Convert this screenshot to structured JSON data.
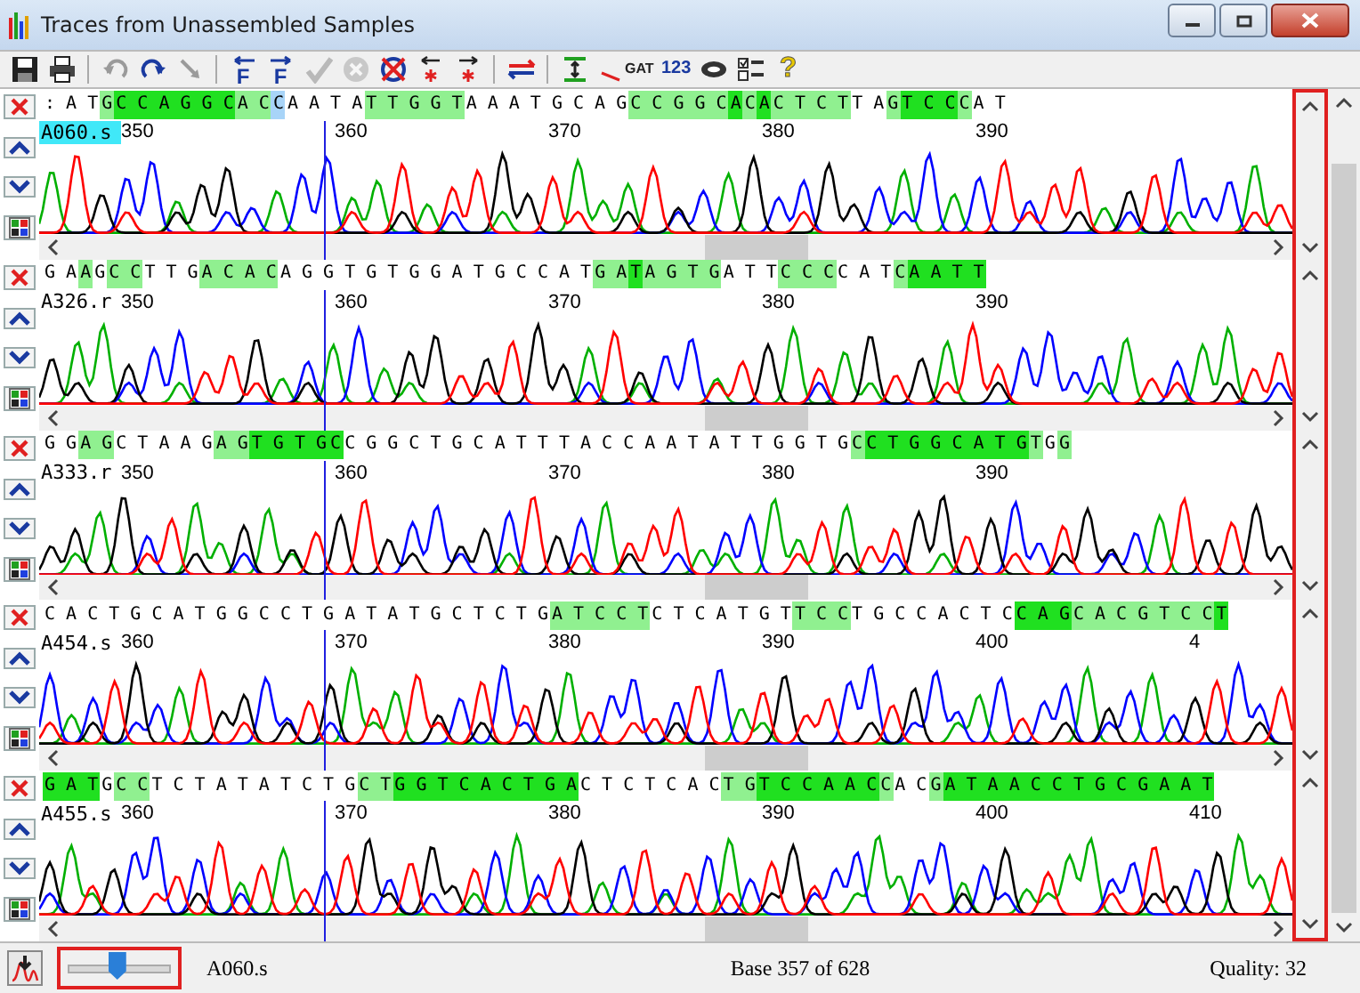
{
  "window": {
    "title": "Traces from Unassembled Samples"
  },
  "toolbar": [
    {
      "kind": "save",
      "disabled": false
    },
    {
      "kind": "print",
      "disabled": false
    },
    {
      "kind": "undo",
      "disabled": true
    },
    {
      "kind": "redo",
      "disabled": false
    },
    {
      "kind": "step",
      "disabled": true
    },
    {
      "kind": "jump-left",
      "glyph": "F",
      "disabled": false
    },
    {
      "kind": "jump-right",
      "glyph": "F",
      "disabled": false
    },
    {
      "kind": "check",
      "disabled": true
    },
    {
      "kind": "cancel",
      "disabled": true
    },
    {
      "kind": "delete",
      "disabled": false
    },
    {
      "kind": "mark-left",
      "disabled": false
    },
    {
      "kind": "mark-right",
      "disabled": false
    },
    {
      "kind": "swap",
      "disabled": false
    },
    {
      "kind": "align",
      "disabled": false
    },
    {
      "kind": "translate",
      "glyph": "GAT",
      "disabled": false
    },
    {
      "kind": "numbers",
      "glyph": "123",
      "disabled": false
    },
    {
      "kind": "link",
      "disabled": false
    },
    {
      "kind": "options",
      "disabled": false
    },
    {
      "kind": "help",
      "glyph": "?",
      "disabled": false
    }
  ],
  "tracks": [
    {
      "name": "A060.s",
      "selected": true,
      "ruler": [
        "350",
        "360",
        "370",
        "380",
        "390"
      ],
      "bases": [
        {
          "text": ": A T",
          "kind": "none"
        },
        {
          "text": "G",
          "kind": "light"
        },
        {
          "text": "C C A G G C",
          "kind": "dark"
        },
        {
          "text": "A C",
          "kind": "light"
        },
        {
          "text": "C",
          "kind": "cursor"
        },
        {
          "text": "A A T A",
          "kind": "none"
        },
        {
          "text": "T T G G T",
          "kind": "light"
        },
        {
          "text": "A A A T G C A G",
          "kind": "none"
        },
        {
          "text": "C C G G C",
          "kind": "light"
        },
        {
          "text": "A",
          "kind": "dark"
        },
        {
          "text": "C",
          "kind": "light"
        },
        {
          "text": "A",
          "kind": "dark"
        },
        {
          "text": "C T C T",
          "kind": "light"
        },
        {
          "text": "T A",
          "kind": "none"
        },
        {
          "text": "G",
          "kind": "light"
        },
        {
          "text": "T C C",
          "kind": "dark"
        },
        {
          "text": "C",
          "kind": "light"
        },
        {
          "text": "A T",
          "kind": "none"
        }
      ]
    },
    {
      "name": "A326.r",
      "selected": false,
      "ruler": [
        "350",
        "360",
        "370",
        "380",
        "390"
      ],
      "bases": [
        {
          "text": "G A",
          "kind": "none"
        },
        {
          "text": "A",
          "kind": "light"
        },
        {
          "text": "G",
          "kind": "none"
        },
        {
          "text": "C C",
          "kind": "light"
        },
        {
          "text": "T T G",
          "kind": "none"
        },
        {
          "text": "A C A C",
          "kind": "light"
        },
        {
          "text": "A G G T G T G G A T G C C A T",
          "kind": "none"
        },
        {
          "text": "G A",
          "kind": "light"
        },
        {
          "text": "T",
          "kind": "dark"
        },
        {
          "text": "A G T G",
          "kind": "light"
        },
        {
          "text": "A T T",
          "kind": "none"
        },
        {
          "text": "C C C",
          "kind": "light"
        },
        {
          "text": "C A T",
          "kind": "none"
        },
        {
          "text": "C",
          "kind": "light"
        },
        {
          "text": "A A T T",
          "kind": "dark"
        }
      ]
    },
    {
      "name": "A333.r",
      "selected": false,
      "ruler": [
        "350",
        "360",
        "370",
        "380",
        "390"
      ],
      "bases": [
        {
          "text": "G G",
          "kind": "none"
        },
        {
          "text": "A G",
          "kind": "light"
        },
        {
          "text": "C T A A G",
          "kind": "none"
        },
        {
          "text": "A G",
          "kind": "light"
        },
        {
          "text": "T G T G",
          "kind": "dark"
        },
        {
          "text": "C",
          "kind": "dark"
        },
        {
          "text": "C G G C T G C A T T T A C C A A T A T T G G T G",
          "kind": "none"
        },
        {
          "text": "C",
          "kind": "light"
        },
        {
          "text": "C T G G C A T G",
          "kind": "dark"
        },
        {
          "text": "T",
          "kind": "light"
        },
        {
          "text": "G",
          "kind": "none"
        },
        {
          "text": "G",
          "kind": "light"
        }
      ]
    },
    {
      "name": "A454.s",
      "selected": false,
      "ruler": [
        "360",
        "370",
        "380",
        "390",
        "400",
        "4"
      ],
      "bases": [
        {
          "text": "C A C T G C A T G G C C T G A T A T G C T C T G",
          "kind": "none"
        },
        {
          "text": "A T C C T",
          "kind": "light"
        },
        {
          "text": "C T C A T G T",
          "kind": "none"
        },
        {
          "text": "T C C",
          "kind": "light"
        },
        {
          "text": "T G C C A C T C",
          "kind": "none"
        },
        {
          "text": "C A G",
          "kind": "dark"
        },
        {
          "text": "C A C G T C C",
          "kind": "light"
        },
        {
          "text": "T",
          "kind": "dark"
        }
      ]
    },
    {
      "name": "A455.s",
      "selected": false,
      "ruler": [
        "360",
        "370",
        "380",
        "390",
        "400",
        "410"
      ],
      "bases": [
        {
          "text": "G A T",
          "kind": "dark"
        },
        {
          "text": "G",
          "kind": "none"
        },
        {
          "text": "C C",
          "kind": "light"
        },
        {
          "text": "T C T A T A T C T G",
          "kind": "none"
        },
        {
          "text": "C T",
          "kind": "light"
        },
        {
          "text": "G G T C A C T G A",
          "kind": "dark"
        },
        {
          "text": "C T C T C A C",
          "kind": "none"
        },
        {
          "text": "T G",
          "kind": "light"
        },
        {
          "text": "T C C A A C",
          "kind": "dark"
        },
        {
          "text": "C",
          "kind": "light"
        },
        {
          "text": "A C",
          "kind": "none"
        },
        {
          "text": "G",
          "kind": "light"
        },
        {
          "text": "A T A A C C T G C G A A T",
          "kind": "dark"
        }
      ]
    }
  ],
  "status": {
    "slider": {
      "level": 0.48
    },
    "sample": "A060.s",
    "position": "Base 357 of 628",
    "quality": "Quality: 32"
  }
}
